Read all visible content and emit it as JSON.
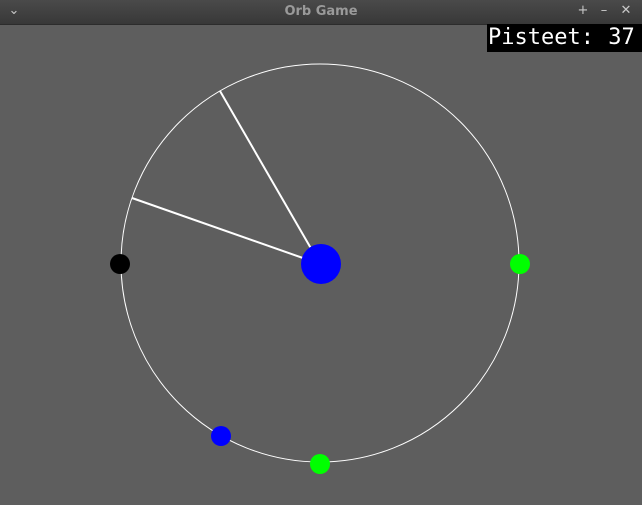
{
  "window": {
    "title": "Orb Game",
    "menu_icon": "chevron-down-icon",
    "pin_icon": "plus-icon",
    "minimize_icon": "minus-icon",
    "close_icon": "close-icon"
  },
  "hud": {
    "score_label": "Pisteet:",
    "score_value": "37"
  },
  "colors": {
    "background": "#5e5e5e",
    "ring": "#ffffff",
    "player": "#0000ff",
    "orb_green": "#00ff00",
    "orb_blue": "#0000ff",
    "orb_black": "#000000"
  },
  "game": {
    "center_orb_color": "blue",
    "orbs": [
      {
        "color": "black"
      },
      {
        "color": "green"
      },
      {
        "color": "blue"
      },
      {
        "color": "green"
      }
    ]
  }
}
